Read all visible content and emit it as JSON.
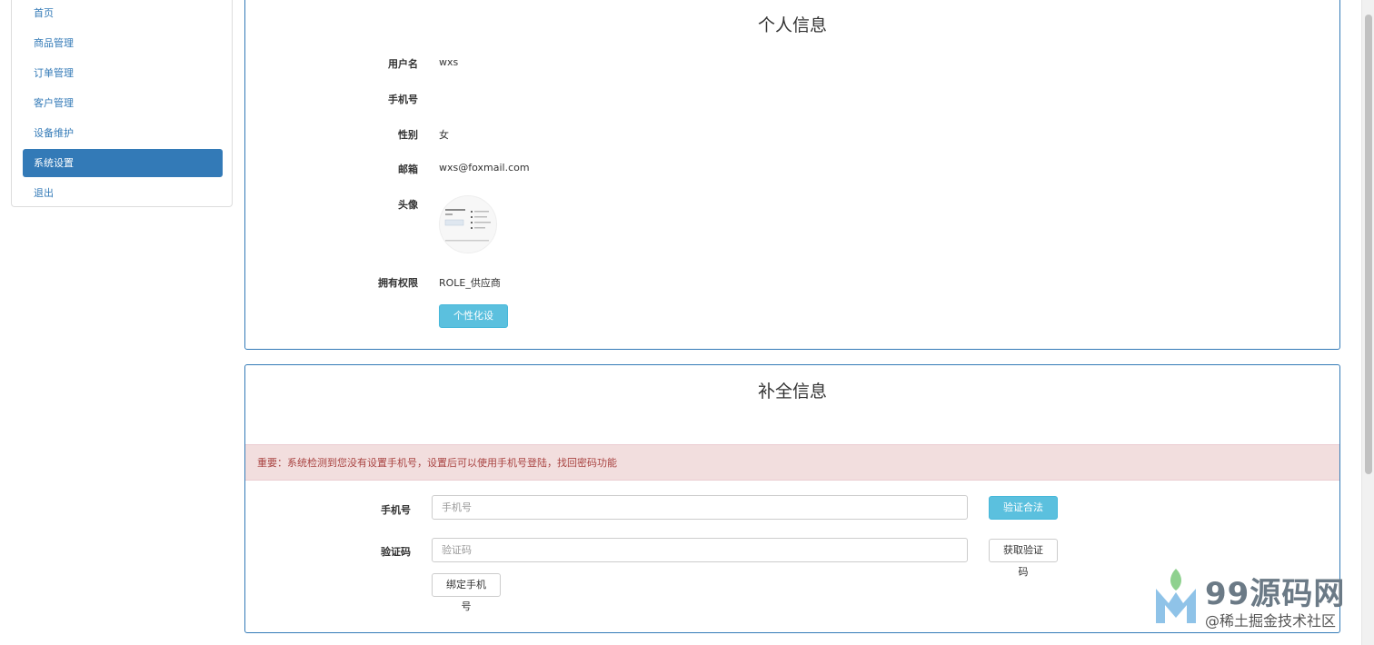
{
  "sidebar": {
    "items": [
      {
        "label": "首页",
        "active": false
      },
      {
        "label": "商品管理",
        "active": false
      },
      {
        "label": "订单管理",
        "active": false
      },
      {
        "label": "客户管理",
        "active": false
      },
      {
        "label": "设备维护",
        "active": false
      },
      {
        "label": "系统设置",
        "active": true
      },
      {
        "label": "退出",
        "active": false
      }
    ]
  },
  "profile": {
    "title": "个人信息",
    "username_label": "用户名",
    "username": "wxs",
    "phone_label": "手机号",
    "phone": "",
    "gender_label": "性别",
    "gender": "女",
    "email_label": "邮箱",
    "email": "wxs@foxmail.com",
    "avatar_label": "头像",
    "role_label": "拥有权限",
    "role": "ROLE_供应商",
    "settings_button": "个性化设置"
  },
  "complete": {
    "title": "补全信息",
    "alert": "重要：系统检测到您没有设置手机号，设置后可以使用手机号登陆，找回密码功能",
    "phone_label": "手机号",
    "phone_placeholder": "手机号",
    "phone_value": "",
    "validate_button": "验证合法性",
    "code_label": "验证码",
    "code_placeholder": "验证码",
    "code_value": "",
    "get_code_button": "获取验证码",
    "bind_button": "绑定手机号"
  },
  "watermark": {
    "brand": "99源码网",
    "sub": "@稀土掘金技术社区"
  },
  "colors": {
    "primary": "#337ab7",
    "info": "#5bc0de",
    "danger_bg": "#f2dede",
    "danger_text": "#a94442"
  }
}
